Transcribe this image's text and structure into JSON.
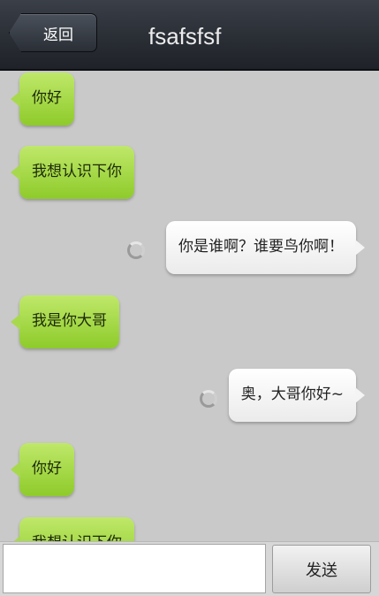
{
  "header": {
    "back_label": "返回",
    "title": "fsafsfsf"
  },
  "messages": [
    {
      "side": "left",
      "text": "你好"
    },
    {
      "side": "left",
      "text": "我想认识下你"
    },
    {
      "side": "right",
      "text": "你是谁啊？谁要鸟你啊！"
    },
    {
      "side": "left",
      "text": "我是你大哥"
    },
    {
      "side": "right",
      "text": "奥，大哥你好~"
    },
    {
      "side": "left",
      "text": "你好"
    },
    {
      "side": "left",
      "text": "我想认识下你"
    }
  ],
  "composer": {
    "input_value": "",
    "send_label": "发送"
  },
  "colors": {
    "incoming_bubble": "#a8d94d",
    "outgoing_bubble": "#ffffff",
    "chat_background": "#c9c9c9",
    "titlebar": "#2a2e35"
  }
}
